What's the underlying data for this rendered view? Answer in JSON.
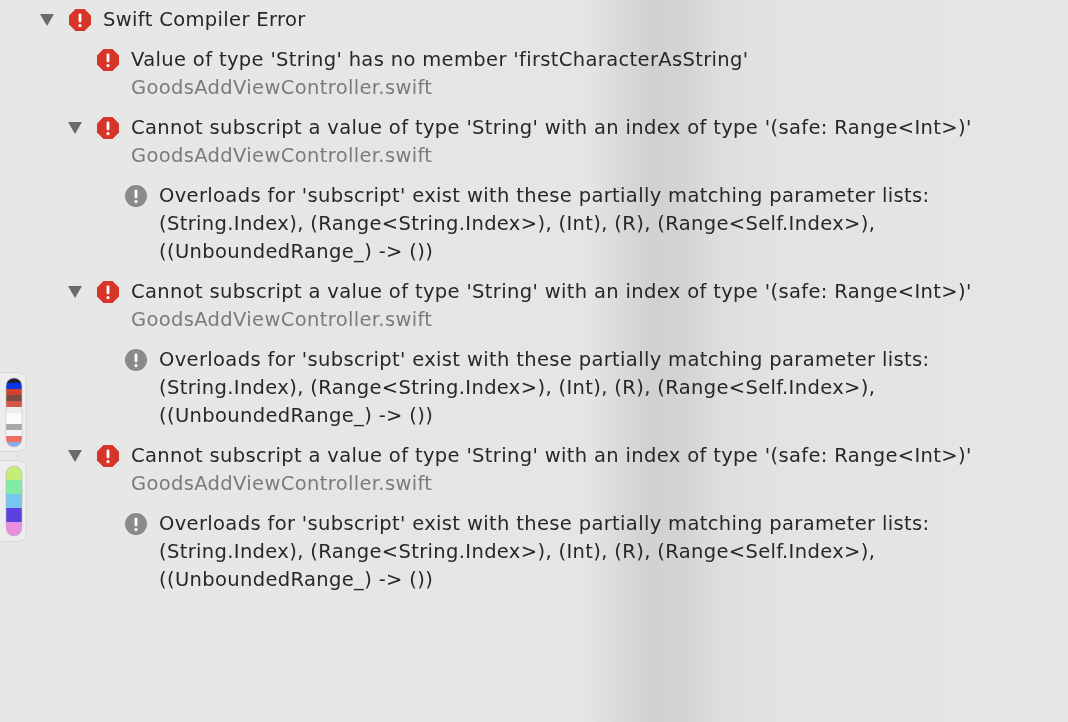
{
  "issue_navigator": {
    "kind": "error",
    "expanded": true,
    "title": "Swift Compiler Error",
    "children": [
      {
        "kind": "error",
        "message": "Value of type 'String' has no member 'firstCharacterAsString'",
        "file": "GoodsAddViewController.swift"
      },
      {
        "kind": "error",
        "expanded": true,
        "message": "Cannot subscript a value of type 'String' with an index of type '(safe: Range<Int>)'",
        "file": "GoodsAddViewController.swift",
        "children": [
          {
            "kind": "note",
            "message": "Overloads for 'subscript' exist with these partially matching parameter lists:\n(String.Index), (Range<String.Index>), (Int), (R), (Range<Self.Index>),\n((UnboundedRange_) -> ())"
          }
        ]
      },
      {
        "kind": "error",
        "expanded": true,
        "message": "Cannot subscript a value of type 'String' with an index of type '(safe: Range<Int>)'",
        "file": "GoodsAddViewController.swift",
        "children": [
          {
            "kind": "note",
            "message": "Overloads for 'subscript' exist with these partially matching parameter lists:\n(String.Index), (Range<String.Index>), (Int), (R), (Range<Self.Index>),\n((UnboundedRange_) -> ())"
          }
        ]
      },
      {
        "kind": "error",
        "expanded": true,
        "message": "Cannot subscript a value of type 'String' with an index of type '(safe: Range<Int>)'",
        "file": "GoodsAddViewController.swift",
        "children": [
          {
            "kind": "note",
            "message": "Overloads for 'subscript' exist with these partially matching parameter lists:\n(String.Index), (Range<String.Index>), (Int), (R), (Range<Self.Index>),\n((UnboundedRange_) -> ())"
          }
        ]
      }
    ]
  }
}
